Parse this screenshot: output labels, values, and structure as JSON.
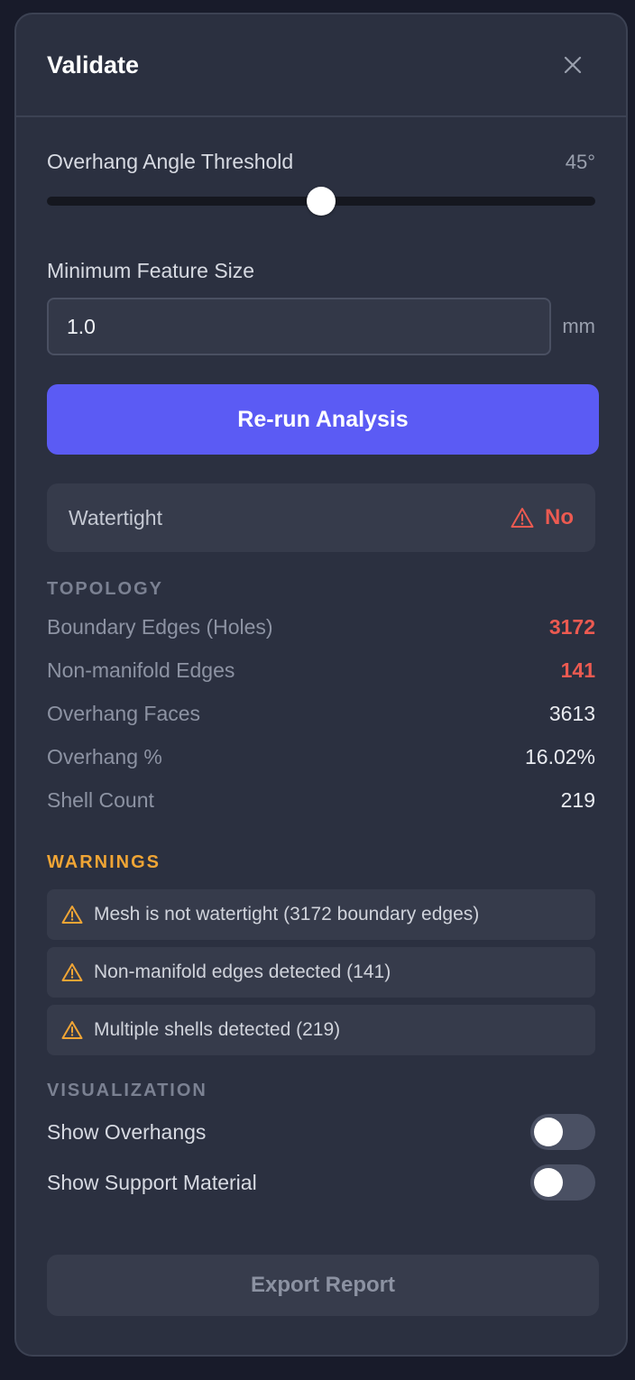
{
  "panel": {
    "title": "Validate",
    "close_icon": "close-icon"
  },
  "overhang": {
    "label": "Overhang Angle Threshold",
    "value_text": "45°",
    "value": 45,
    "min": 0,
    "max": 90
  },
  "feature_size": {
    "label": "Minimum Feature Size",
    "value": "1.0",
    "unit": "mm"
  },
  "rerun_label": "Re-run Analysis",
  "watertight": {
    "label": "Watertight",
    "value": "No",
    "icon": "warning-icon",
    "color": "#ec5a51"
  },
  "topology": {
    "title": "TOPOLOGY",
    "rows": [
      {
        "label": "Boundary Edges (Holes)",
        "value": "3172",
        "alert": true
      },
      {
        "label": "Non-manifold Edges",
        "value": "141",
        "alert": true
      },
      {
        "label": "Overhang Faces",
        "value": "3613",
        "alert": false
      },
      {
        "label": "Overhang %",
        "value": "16.02%",
        "alert": false
      },
      {
        "label": "Shell Count",
        "value": "219",
        "alert": false
      }
    ]
  },
  "warnings": {
    "title": "WARNINGS",
    "color": "#f0a535",
    "items": [
      {
        "text": "Mesh is not watertight (3172 boundary edges)",
        "icon": "warning-icon"
      },
      {
        "text": "Non-manifold edges detected (141)",
        "icon": "warning-icon"
      },
      {
        "text": "Multiple shells detected (219)",
        "icon": "warning-icon"
      }
    ]
  },
  "visualization": {
    "title": "VISUALIZATION",
    "toggles": [
      {
        "label": "Show Overhangs",
        "on": false
      },
      {
        "label": "Show Support Material",
        "on": false
      }
    ]
  },
  "export_label": "Export Report",
  "colors": {
    "accent": "#5b5bf4",
    "panel_bg": "#2b3040",
    "danger": "#ec5a51",
    "warning": "#f0a535"
  }
}
